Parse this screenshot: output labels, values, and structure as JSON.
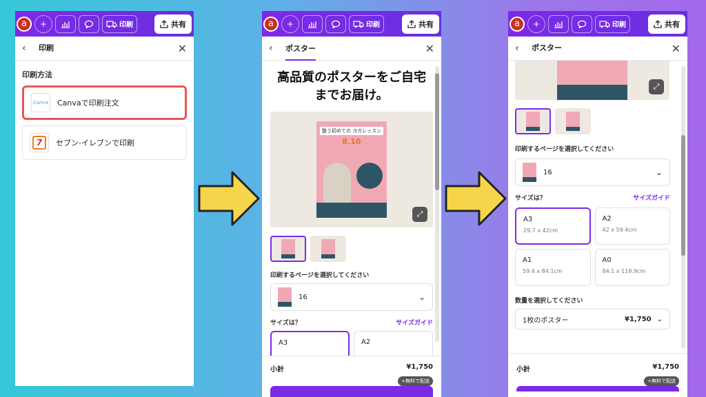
{
  "topbar": {
    "avatar_letter": "a",
    "print_label": "印刷",
    "share_label": "共有"
  },
  "panel1": {
    "title": "印刷",
    "section_label": "印刷方法",
    "methods": [
      {
        "logo": "Canva",
        "label": "Canvaで印刷注文"
      },
      {
        "logo": "7",
        "label": "セブン-イレブンで印刷"
      }
    ]
  },
  "panel2": {
    "title": "ポスター",
    "headline_line1": "高品質のポスターをご自宅",
    "headline_line2": "までお届け。",
    "poster_title": "整う初めての\nヨガレッスン",
    "poster_date": "8.10",
    "page_select_label": "印刷するページを選択してください",
    "page_value": "16",
    "size_question": "サイズは？",
    "size_guide": "サイズガイド",
    "sizes": [
      {
        "name": "A3",
        "dim": ""
      },
      {
        "name": "A2",
        "dim": ""
      }
    ],
    "subtotal_label": "小計",
    "subtotal_value": "¥1,750",
    "free_shipping": "+無料で配送"
  },
  "panel3": {
    "title": "ポスター",
    "page_select_label": "印刷するページを選択してください",
    "page_value": "16",
    "size_question": "サイズは？",
    "size_guide": "サイズガイド",
    "sizes": [
      {
        "name": "A3",
        "dim": "29.7 x 42cm"
      },
      {
        "name": "A2",
        "dim": "42 x 59.4cm"
      },
      {
        "name": "A1",
        "dim": "59.4 x 84.1cm"
      },
      {
        "name": "A0",
        "dim": "84.1 x 118.9cm"
      }
    ],
    "qty_label": "数量を選択してください",
    "qty_value": "1枚のポスター",
    "qty_price": "¥1,750",
    "subtotal_label": "小計",
    "subtotal_value": "¥1,750",
    "free_shipping": "+無料で配送"
  },
  "colors": {
    "brand_purple": "#7d2ae8",
    "highlight_red": "#e85555",
    "arrow_yellow": "#f7d54a"
  },
  "icons": [
    "chevron-left-icon",
    "close-icon",
    "plus-icon",
    "chart-icon",
    "comment-icon",
    "truck-icon",
    "share-icon",
    "expand-icon",
    "chevron-down-icon"
  ]
}
